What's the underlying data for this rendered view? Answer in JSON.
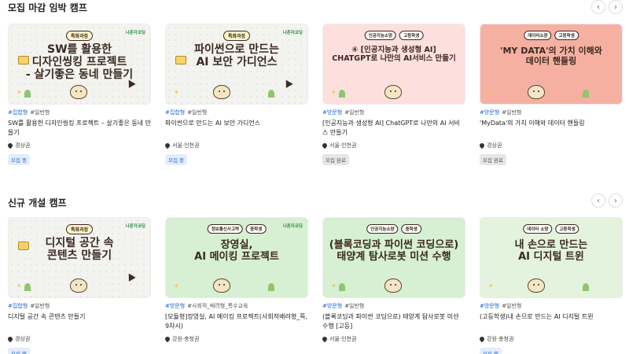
{
  "sections": [
    {
      "title": "모집 마감 임박 캠프",
      "nav": {
        "prev": "‹",
        "next": "›"
      },
      "cards": [
        {
          "thumb": {
            "style": "gray",
            "badge": "특화과정",
            "tags": [],
            "title": "SW를 활용한\n디자인씽킹 프로젝트\n- 살기좋은 동네 만들기",
            "logo": "나혼자코딩"
          },
          "tags": [
            "#집합형",
            "#일반형"
          ],
          "title": "SW를 활용한 디자인씽킹 프로젝트 – 살기좋은 동네 만들기",
          "region": "경상권",
          "status": "모집 중",
          "status_type": "open"
        },
        {
          "thumb": {
            "style": "gray",
            "badge": "특화과정",
            "tags": [],
            "title": "파이썬으로 만드는\nAI 보안 가디언스",
            "logo": "나혼자코딩"
          },
          "tags": [
            "#집합형",
            "#일반형"
          ],
          "title": "파이썬으로 만드는 AI 보안 가디언스",
          "region": "서울·인천권",
          "status": "모집 중",
          "status_type": "open"
        },
        {
          "thumb": {
            "style": "pink",
            "badge": "",
            "tags": [
              "인공지능소양",
              "고등학생"
            ],
            "title": "④ [인공지능과 생성형 AI]\nCHATGPT로 나만의 AI서비스 만들기",
            "logo": ""
          },
          "tags": [
            "#방문형",
            "#일반형"
          ],
          "title": "[인공지능과 생성형 AI] ChatGPT로 나만의 AI 서비스 만들기",
          "region": "서울·인천권",
          "status": "모집 완료",
          "status_type": "closed"
        },
        {
          "thumb": {
            "style": "coral",
            "badge": "",
            "tags": [
              "데이터소양",
              "고등학생"
            ],
            "title": "'MY DATA'의 가치 이해와\n데이터 핸들링",
            "logo": ""
          },
          "tags": [
            "#방문형",
            "#일반형"
          ],
          "title": "'MyData'의 가치 이해와 데이터 핸들링",
          "region": "경상권",
          "status": "모집 완료",
          "status_type": "closed"
        }
      ]
    },
    {
      "title": "신규 개설 캠프",
      "nav": {
        "prev": "‹",
        "next": "›"
      },
      "cards": [
        {
          "thumb": {
            "style": "gray",
            "badge": "특화과정",
            "tags": [],
            "title": "디지털 공간 속\n콘텐츠 만들기",
            "logo": "나혼자코딩"
          },
          "tags": [
            "#집합형",
            "#일반형"
          ],
          "title": "디지털 공간 속 콘텐츠 만들기",
          "region": "경상권",
          "status": "모집 중",
          "status_type": "open"
        },
        {
          "thumb": {
            "style": "mint",
            "badge": "",
            "tags": [
              "정보통신사고력",
              "중학생"
            ],
            "title": "장영실,\nAI 메이킹 프로젝트",
            "logo": "나혼자코딩"
          },
          "tags": [
            "#방문형",
            "#사회적_배려형_특수교육"
          ],
          "title": "[모듈형]장영실, AI 메이킹 프로젝트(사회적배려형_특, 9차시)",
          "region": "강원·충청권",
          "status": "",
          "status_type": "closed"
        },
        {
          "thumb": {
            "style": "mint",
            "badge": "",
            "tags": [
              "인공지능소양",
              "중학생"
            ],
            "title": "(블록코딩과 파이썬 코딩으로)\n태양계 탐사로봇 미션 수행",
            "logo": ""
          },
          "tags": [
            "#방문형",
            "#일반형"
          ],
          "title": "(블록코딩과 파이썬 코딩으로) 태양계 탐사로봇 미션 수행 [고등]",
          "region": "서울·인천권",
          "status": "",
          "status_type": "closed"
        },
        {
          "thumb": {
            "style": "mint2",
            "badge": "",
            "tags": [
              "데이터 소양",
              "고등학생"
            ],
            "title": "내 손으로 만드는\nAI 디지털 트윈",
            "logo": ""
          },
          "tags": [
            "#방문형",
            "#일반형"
          ],
          "title": "(고등학생)내 손으로 만드는 AI 디지털 트윈",
          "region": "강원·충청권",
          "status": "모집 중",
          "status_type": "open"
        }
      ]
    }
  ]
}
